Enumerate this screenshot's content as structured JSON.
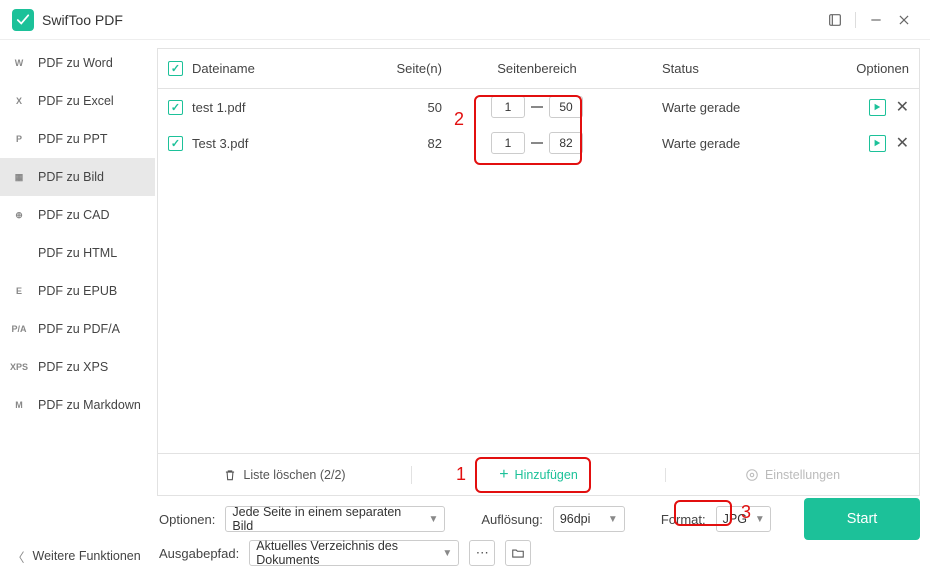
{
  "app": {
    "title": "SwifToo PDF"
  },
  "titlebar": {
    "icons": {
      "tool": "tool-icon",
      "minimize": "minimize-icon",
      "close": "close-icon"
    }
  },
  "sidebar": {
    "items": [
      {
        "icon": "W",
        "label": "PDF zu Word"
      },
      {
        "icon": "X",
        "label": "PDF zu Excel"
      },
      {
        "icon": "P",
        "label": "PDF zu PPT"
      },
      {
        "icon": "▦",
        "label": "PDF zu Bild",
        "selected": true
      },
      {
        "icon": "⊕",
        "label": "PDF zu CAD"
      },
      {
        "icon": "</>",
        "label": "PDF zu HTML"
      },
      {
        "icon": "E",
        "label": "PDF zu EPUB"
      },
      {
        "icon": "P/A",
        "label": "PDF zu PDF/A"
      },
      {
        "icon": "XPS",
        "label": "PDF zu XPS"
      },
      {
        "icon": "M",
        "label": "PDF zu Markdown"
      }
    ],
    "more_label": "Weitere Funktionen"
  },
  "table": {
    "headers": {
      "filename": "Dateiname",
      "pages": "Seite(n)",
      "range": "Seitenbereich",
      "status": "Status",
      "options": "Optionen"
    },
    "rows": [
      {
        "checked": true,
        "name": "test 1.pdf",
        "pages": "50",
        "from": "1",
        "to": "50",
        "status": "Warte gerade"
      },
      {
        "checked": true,
        "name": "Test 3.pdf",
        "pages": "82",
        "from": "1",
        "to": "82",
        "status": "Warte gerade"
      }
    ]
  },
  "panel_footer": {
    "clear": "Liste löschen (2/2)",
    "add": "Hinzufügen",
    "settings": "Einstellungen"
  },
  "options": {
    "opt_label": "Optionen:",
    "opt_value": "Jede Seite in einem separaten Bild",
    "res_label": "Auflösung:",
    "res_value": "96dpi",
    "fmt_label": "Format:",
    "fmt_value": "JPG",
    "out_label": "Ausgabepfad:",
    "out_value": "Aktuelles Verzeichnis des Dokuments",
    "start": "Start"
  },
  "callouts": {
    "1": "1",
    "2": "2",
    "3": "3"
  }
}
